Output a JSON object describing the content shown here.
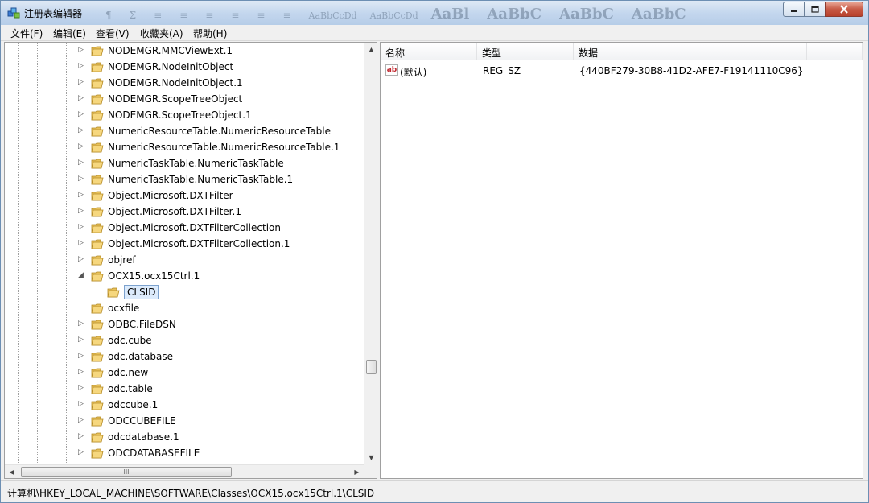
{
  "window": {
    "title": "注册表编辑器",
    "ghost_toolbar": [
      "¶",
      "Σ",
      "≡",
      "≡",
      "≡",
      "≡",
      "≡",
      "≡",
      "AaBbCcDd",
      "AaBbCcDd",
      "AaBl",
      "AaBbC",
      "AaBbC",
      "AaBbC"
    ]
  },
  "menu": [
    {
      "label": "文件(F)"
    },
    {
      "label": "编辑(E)"
    },
    {
      "label": "查看(V)"
    },
    {
      "label": "收藏夹(A)"
    },
    {
      "label": "帮助(H)"
    }
  ],
  "tree": {
    "items": [
      {
        "label": "NODEMGR.MMCViewExt.1",
        "expander": "▷"
      },
      {
        "label": "NODEMGR.NodeInitObject",
        "expander": "▷"
      },
      {
        "label": "NODEMGR.NodeInitObject.1",
        "expander": "▷"
      },
      {
        "label": "NODEMGR.ScopeTreeObject",
        "expander": "▷"
      },
      {
        "label": "NODEMGR.ScopeTreeObject.1",
        "expander": "▷"
      },
      {
        "label": "NumericResourceTable.NumericResourceTable",
        "expander": "▷"
      },
      {
        "label": "NumericResourceTable.NumericResourceTable.1",
        "expander": "▷"
      },
      {
        "label": "NumericTaskTable.NumericTaskTable",
        "expander": "▷"
      },
      {
        "label": "NumericTaskTable.NumericTaskTable.1",
        "expander": "▷"
      },
      {
        "label": "Object.Microsoft.DXTFilter",
        "expander": "▷"
      },
      {
        "label": "Object.Microsoft.DXTFilter.1",
        "expander": "▷"
      },
      {
        "label": "Object.Microsoft.DXTFilterCollection",
        "expander": "▷"
      },
      {
        "label": "Object.Microsoft.DXTFilterCollection.1",
        "expander": "▷"
      },
      {
        "label": "objref",
        "expander": "▷"
      },
      {
        "label": "OCX15.ocx15Ctrl.1",
        "expander": "◢"
      },
      {
        "label": "CLSID",
        "expander": "",
        "child": true,
        "selected": true
      },
      {
        "label": "ocxfile",
        "expander": ""
      },
      {
        "label": "ODBC.FileDSN",
        "expander": "▷"
      },
      {
        "label": "odc.cube",
        "expander": "▷"
      },
      {
        "label": "odc.database",
        "expander": "▷"
      },
      {
        "label": "odc.new",
        "expander": "▷"
      },
      {
        "label": "odc.table",
        "expander": "▷"
      },
      {
        "label": "odccube.1",
        "expander": "▷"
      },
      {
        "label": "ODCCUBEFILE",
        "expander": "▷"
      },
      {
        "label": "odcdatabase.1",
        "expander": "▷"
      },
      {
        "label": "ODCDATABASEFILE",
        "expander": "▷"
      }
    ],
    "hscroll_grip": "III"
  },
  "values": {
    "columns": [
      {
        "label": "名称"
      },
      {
        "label": "类型"
      },
      {
        "label": "数据"
      }
    ],
    "rows": [
      {
        "icon": "ab",
        "name": "(默认)",
        "type": "REG_SZ",
        "data": "{440BF279-30B8-41D2-AFE7-F19141110C96}"
      }
    ]
  },
  "status": {
    "path": "计算机\\HKEY_LOCAL_MACHINE\\SOFTWARE\\Classes\\OCX15.ocx15Ctrl.1\\CLSID"
  },
  "colors": {
    "selection_bg": "#dcebfc",
    "selection_border": "#7da2ce",
    "folder": "#e8c15a",
    "titlebar": "#c4d7ee",
    "close_button": "#c75a45"
  }
}
